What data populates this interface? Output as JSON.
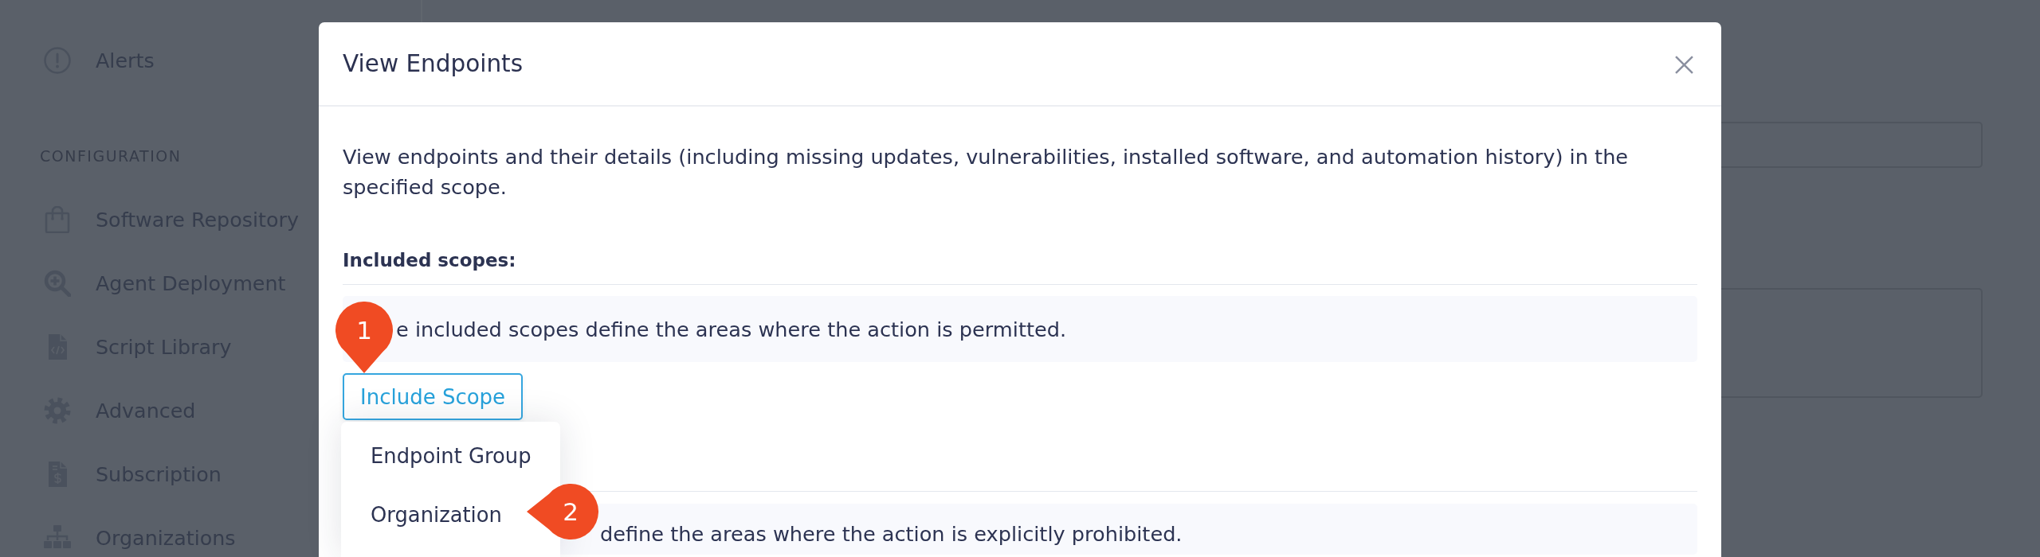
{
  "sidebar": {
    "items": [
      {
        "label": "Alerts"
      }
    ],
    "section": {
      "title": "CONFIGURATION",
      "items": [
        {
          "label": "Software Repository"
        },
        {
          "label": "Agent Deployment"
        },
        {
          "label": "Script Library"
        },
        {
          "label": "Advanced"
        },
        {
          "label": "Subscription"
        },
        {
          "label": "Organizations"
        }
      ]
    }
  },
  "dialog": {
    "title": "View Endpoints",
    "description": "View endpoints and their details (including missing updates, vulnerabilities, installed software, and automation history) in the specified scope.",
    "included": {
      "heading": "Included scopes:",
      "note": "e included scopes define the areas where the action is permitted.",
      "button": "Include Scope"
    },
    "excluded": {
      "note": "define the areas where the action is explicitly prohibited."
    }
  },
  "dropdown": {
    "items": [
      {
        "label": "Endpoint Group"
      },
      {
        "label": "Organization"
      }
    ]
  },
  "callouts": [
    {
      "number": "1"
    },
    {
      "number": "2"
    }
  ]
}
